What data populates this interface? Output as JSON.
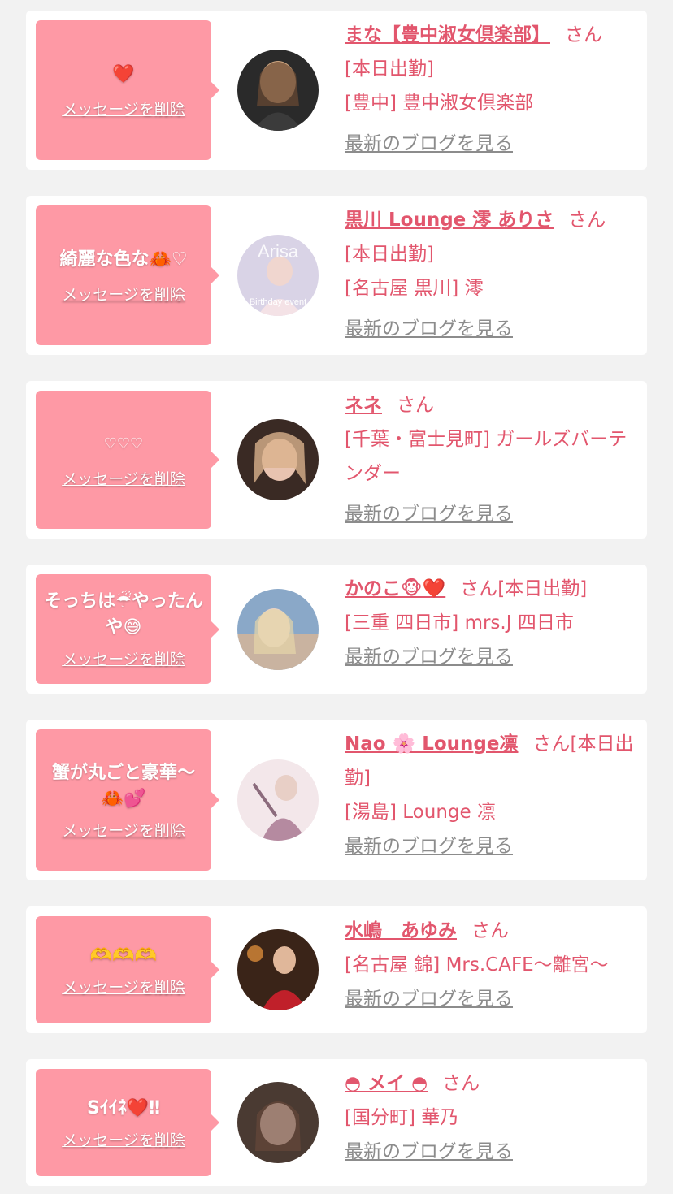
{
  "cards": [
    {
      "message": "❤️",
      "delete_label": "メッセージを削除",
      "name": "まな【豊中淑女倶楽部】",
      "honorific": "さん",
      "status": "[本日出勤]",
      "shop": "[豊中] 豊中淑女倶楽部",
      "blog_label": "最新のブログを見る",
      "avatar_colors": [
        "#2a2a2a",
        "#c9a27e"
      ]
    },
    {
      "message": "綺麗な色な🦀♡",
      "delete_label": "メッセージを削除",
      "name": "黒川 Lounge 澪 ありさ",
      "honorific": "さん",
      "status": "[本日出勤]",
      "shop": "[名古屋 黒川] 澪",
      "blog_label": "最新のブログを見る",
      "avatar_text": "Arisa",
      "avatar_caption": "Birthday event",
      "avatar_colors": [
        "#d9d3e6",
        "#b9a7c9"
      ]
    },
    {
      "message": "♡♡♡",
      "delete_label": "メッセージを削除",
      "name": "ネネ",
      "honorific": "さん",
      "shop": "[千葉・富士見町] ガールズバーテンダー",
      "blog_label": "最新のブログを見る",
      "avatar_colors": [
        "#3a2a24",
        "#e8c3b0"
      ]
    },
    {
      "message": "そっちは☔やったんや😅",
      "delete_label": "メッセージを削除",
      "name": "かのこ🐵❤️",
      "honorific": "さん",
      "status": "[本日出勤]",
      "shop": "[三重 四日市] mrs.J 四日市",
      "blog_label": "最新のブログを見る",
      "avatar_colors": [
        "#8aa8c8",
        "#e9d2c6"
      ]
    },
    {
      "message": "蟹が丸ごと豪華〜🦀💕",
      "delete_label": "メッセージを削除",
      "name": "Nao 🌸 Lounge凛",
      "honorific": "さん",
      "status": "[本日出勤]",
      "shop": "[湯島] Lounge 凛",
      "blog_label": "最新のブログを見る",
      "avatar_colors": [
        "#f3e7ea",
        "#b58aa0"
      ]
    },
    {
      "message": "🫶🫶🫶",
      "delete_label": "メッセージを削除",
      "name": "水嶋　あゆみ",
      "honorific": "さん",
      "shop": "[名古屋 錦] Mrs.CAFE〜離宮〜",
      "blog_label": "最新のブログを見る",
      "avatar_colors": [
        "#3a2418",
        "#c0202a"
      ]
    },
    {
      "message": "Sｲｲﾈ❤️‼",
      "delete_label": "メッセージを削除",
      "name": "◓ メイ ◓",
      "honorific": "さん",
      "shop": "[国分町] 華乃",
      "blog_label": "最新のブログを見る",
      "avatar_colors": [
        "#4a3a32",
        "#e8cfc6"
      ]
    }
  ]
}
